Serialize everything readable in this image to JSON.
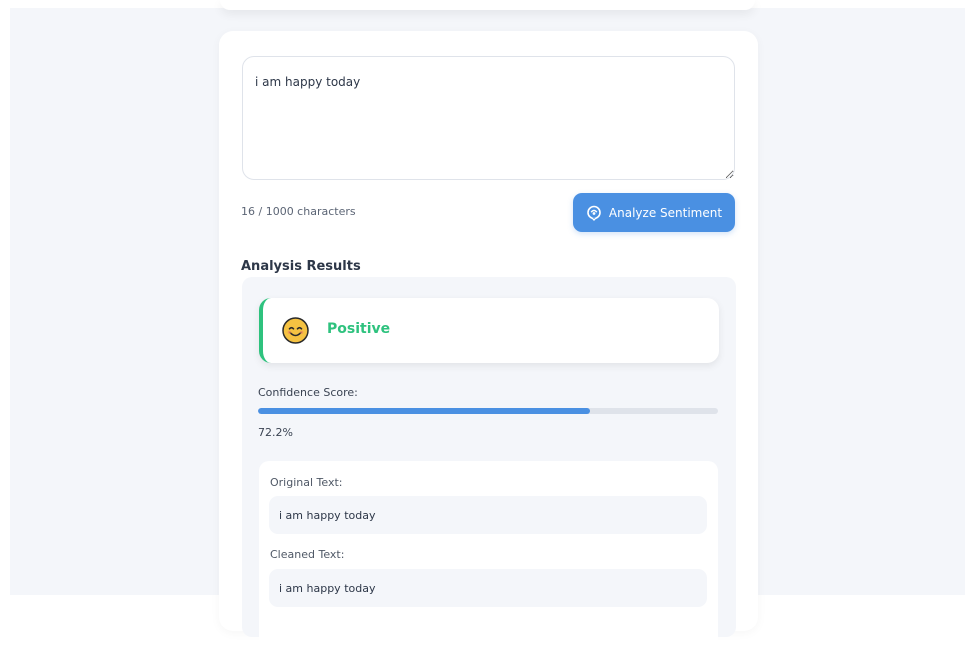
{
  "input": {
    "value": "i am happy today",
    "char_count": "16 / 1000 characters"
  },
  "actions": {
    "analyze_label": "Analyze Sentiment",
    "analyze_icon": "brain-icon"
  },
  "results": {
    "heading": "Analysis Results",
    "sentiment": {
      "label": "Positive",
      "icon": "smiling-face-icon",
      "color": "#2ec27e"
    },
    "confidence": {
      "label": "Confidence Score:",
      "value_text": "72.2%",
      "value": 0.722
    },
    "original_text": {
      "label": "Original Text:",
      "value": "i am happy today"
    },
    "cleaned_text": {
      "label": "Cleaned Text:",
      "value": "i am happy today"
    }
  },
  "colors": {
    "accent": "#4a90e2",
    "positive": "#2ec27e",
    "background": "#f4f6fa"
  }
}
